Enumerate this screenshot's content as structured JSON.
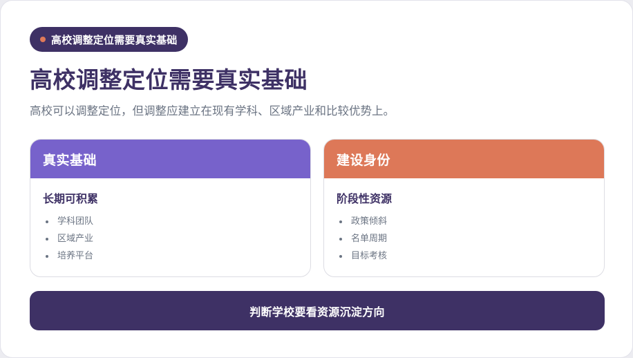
{
  "header": {
    "badge": "高校调整定位需要真实基础",
    "title": "高校调整定位需要真实基础",
    "subtitle": "高校可以调整定位，但调整应建立在现有学科、区域产业和比较优势上。"
  },
  "cards": [
    {
      "heading": "真实基础",
      "subheading": "长期可积累",
      "items": [
        "学科团队",
        "区域产业",
        "培养平台"
      ],
      "accent": "#7762cb"
    },
    {
      "heading": "建设身份",
      "subheading": "阶段性资源",
      "items": [
        "政策倾斜",
        "名单周期",
        "目标考核"
      ],
      "accent": "#dd7858"
    }
  ],
  "action": {
    "label": "判断学校要看资源沉淀方向"
  },
  "colors": {
    "primary": "#3e3165",
    "accent_dot": "#df7a59",
    "muted_text": "#6b7483"
  }
}
